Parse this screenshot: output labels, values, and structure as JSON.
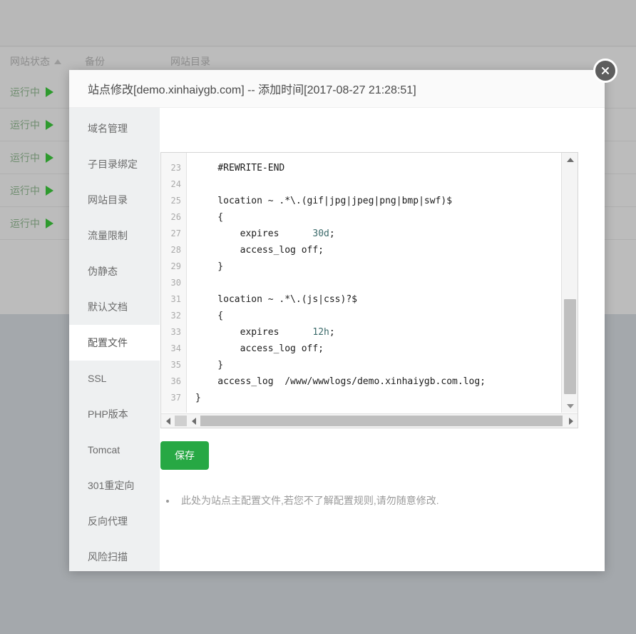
{
  "background": {
    "table_headers": [
      "网站状态",
      "备份",
      "网站目录"
    ],
    "sort_indicator": "sort-asc-caret",
    "rows": [
      {
        "status": "运行中"
      },
      {
        "status": "运行中"
      },
      {
        "status": "运行中"
      },
      {
        "status": "运行中"
      },
      {
        "status": "运行中"
      }
    ]
  },
  "modal": {
    "title": "站点修改[demo.xinhaiygb.com] -- 添加时间[2017-08-27 21:28:51]",
    "close_icon": "close-x-icon",
    "sidebar": {
      "items": [
        {
          "label": "域名管理",
          "active": false
        },
        {
          "label": "子目录绑定",
          "active": false
        },
        {
          "label": "网站目录",
          "active": false
        },
        {
          "label": "流量限制",
          "active": false
        },
        {
          "label": "伪静态",
          "active": false
        },
        {
          "label": "默认文档",
          "active": false
        },
        {
          "label": "配置文件",
          "active": true
        },
        {
          "label": "SSL",
          "active": false
        },
        {
          "label": "PHP版本",
          "active": false
        },
        {
          "label": "Tomcat",
          "active": false
        },
        {
          "label": "301重定向",
          "active": false
        },
        {
          "label": "反向代理",
          "active": false
        },
        {
          "label": "风险扫描",
          "active": false
        }
      ]
    },
    "editor": {
      "first_line_number": 23,
      "lines": [
        {
          "n": 23,
          "text": "    #REWRITE-END"
        },
        {
          "n": 24,
          "text": ""
        },
        {
          "n": 25,
          "text": "    location ~ .*\\.(gif|jpg|jpeg|png|bmp|swf)$"
        },
        {
          "n": 26,
          "text": "    {"
        },
        {
          "n": 27,
          "text": "        expires      30d;"
        },
        {
          "n": 28,
          "text": "        access_log off;"
        },
        {
          "n": 29,
          "text": "    }"
        },
        {
          "n": 30,
          "text": ""
        },
        {
          "n": 31,
          "text": "    location ~ .*\\.(js|css)?$"
        },
        {
          "n": 32,
          "text": "    {"
        },
        {
          "n": 33,
          "text": "        expires      12h;"
        },
        {
          "n": 34,
          "text": "        access_log off;"
        },
        {
          "n": 35,
          "text": "    }"
        },
        {
          "n": 36,
          "text": "    access_log  /www/wwwlogs/demo.xinhaiygb.com.log;"
        },
        {
          "n": 37,
          "text": "}"
        }
      ],
      "vertical_scrollbar": {
        "up_icon": "chevron-up-icon",
        "down_icon": "chevron-down-icon"
      },
      "horizontal_scrollbar": {
        "left_icon": "chevron-left-icon",
        "right_icon": "chevron-right-icon"
      }
    },
    "save_label": "保存",
    "notes": [
      "此处为站点主配置文件,若您不了解配置规则,请勿随意修改."
    ]
  },
  "colors": {
    "accent_green": "#27a844",
    "status_green": "#2e9a2e",
    "sidebar_bg": "#eef0f1",
    "overlay": "#b7b7b7"
  }
}
